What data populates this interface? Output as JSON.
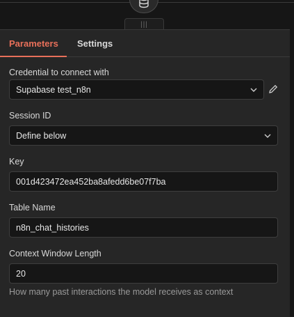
{
  "tabs": [
    {
      "label": "Parameters",
      "active": true
    },
    {
      "label": "Settings",
      "active": false
    }
  ],
  "icons": {
    "node": "database-icon",
    "grip": "drag-handle-icon",
    "edit": "pencil-icon",
    "dropdown": "chevron-down-icon"
  },
  "accent_color": "#e8705a",
  "fields": {
    "credential": {
      "label": "Credential to connect with",
      "value": "Supabase test_n8n"
    },
    "session_id": {
      "label": "Session ID",
      "value": "Define below"
    },
    "key": {
      "label": "Key",
      "value": "001d423472ea452ba8afedd6be07f7ba"
    },
    "table_name": {
      "label": "Table Name",
      "value": "n8n_chat_histories"
    },
    "context_window": {
      "label": "Context Window Length",
      "value": "20",
      "hint": "How many past interactions the model receives as context"
    }
  }
}
